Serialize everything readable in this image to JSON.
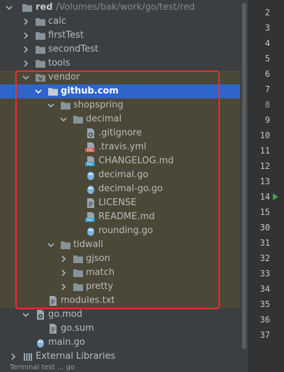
{
  "project": {
    "name": "red",
    "path": "/Volumes/bak/work/go/test/red"
  },
  "tree": {
    "items": [
      {
        "label": "calc"
      },
      {
        "label": "firstTest"
      },
      {
        "label": "secondTest"
      },
      {
        "label": "tools"
      },
      {
        "label": "vendor"
      },
      {
        "label": "github.com"
      },
      {
        "label": "shopspring"
      },
      {
        "label": "decimal"
      },
      {
        "label": ".gitignore"
      },
      {
        "label": ".travis.yml"
      },
      {
        "label": "CHANGELOG.md"
      },
      {
        "label": "decimal.go"
      },
      {
        "label": "decimal-go.go"
      },
      {
        "label": "LICENSE"
      },
      {
        "label": "README.md"
      },
      {
        "label": "rounding.go"
      },
      {
        "label": "tidwall"
      },
      {
        "label": "gjson"
      },
      {
        "label": "match"
      },
      {
        "label": "pretty"
      },
      {
        "label": "modules.txt"
      },
      {
        "label": "go.mod"
      },
      {
        "label": "go.sum"
      },
      {
        "label": "main.go"
      },
      {
        "label": "External Libraries"
      }
    ]
  },
  "status_text": "Terminal   test   ...   go",
  "gutter": {
    "lines": [
      "2",
      "3",
      "4",
      "5",
      "6",
      "7",
      "8",
      "9",
      "10",
      "11",
      "12",
      "13",
      "14",
      "15",
      "30",
      "31",
      "32",
      "33",
      "34",
      "35",
      "36",
      "37"
    ]
  },
  "colors": {
    "selection": "#2f65ca",
    "vendor_highlight": "#4b4838",
    "annotation_box": "#e8302d",
    "run_marker": "#499c54"
  }
}
